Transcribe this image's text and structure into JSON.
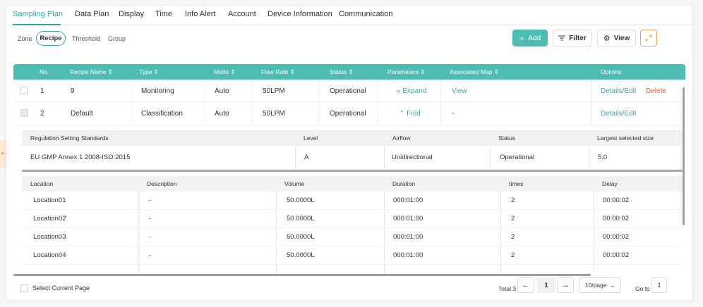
{
  "top_tabs": [
    "Sampling Plan",
    "Data Plan",
    "Display",
    "Time",
    "Info Alert",
    "Account",
    "Device Information",
    "Communication"
  ],
  "sub_tabs": [
    "Zone",
    "Recipe",
    "Threshold",
    "Group"
  ],
  "toolbar": {
    "add": "Add",
    "filter": "Filter",
    "view": "View"
  },
  "table": {
    "headers": [
      "No.",
      "Recipe Name",
      "Type",
      "Mode",
      "Flow Rate",
      "Status",
      "Parameters",
      "Associated Map",
      "Options"
    ],
    "rows": [
      {
        "no": "1",
        "name": "9",
        "type": "Monitoring",
        "mode": "Auto",
        "flow": "50LPM",
        "status": "Operational",
        "param": "Expand",
        "map": "View",
        "opt1": "Details/Edit",
        "opt2": "Delete"
      },
      {
        "no": "2",
        "name": "Default",
        "type": "Classification",
        "mode": "Auto",
        "flow": "50LPM",
        "status": "Operational",
        "param": "Fold",
        "map": "-",
        "opt1": "Details/Edit"
      }
    ]
  },
  "regulation": {
    "headers": [
      "Regulation Setting Standards",
      "Level",
      "Airflow",
      "Status",
      "Largest selected size"
    ],
    "row": [
      "EU GMP Annex 1 2008-ISO:2015",
      "A",
      "Unidirectional",
      "Operational",
      "5.0"
    ]
  },
  "locations": {
    "headers": [
      "Location",
      "Description",
      "Volume",
      "Duration",
      "times",
      "Delay"
    ],
    "rows": [
      [
        "Location01",
        "-",
        "50.0000L",
        "000:01:00",
        "2",
        "00:00:02"
      ],
      [
        "Location02",
        "-",
        "50.0000L",
        "000:01:00",
        "2",
        "00:00:02"
      ],
      [
        "Location03",
        "-",
        "50.0000L",
        "000:01:00",
        "2",
        "00:00:02"
      ],
      [
        "Location04",
        "-",
        "50.0000L",
        "000:01:00",
        "2",
        "00:00:02"
      ]
    ]
  },
  "footer": {
    "select_label": "Select Current Page",
    "total": "Total 3",
    "page": "1",
    "page_size": "10/page",
    "goto_label": "Go to",
    "goto_value": "1"
  },
  "colors": {
    "accent": "#4dbdb4",
    "danger": "#e8594f",
    "warning": "#f0a35c"
  }
}
